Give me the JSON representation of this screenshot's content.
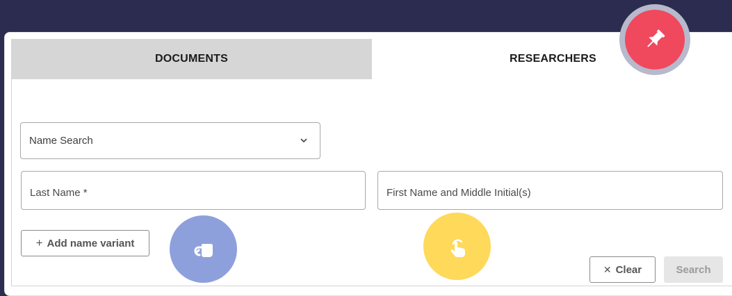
{
  "tabs": {
    "documents": "DOCUMENTS",
    "researchers": "RESEARCHERS"
  },
  "search_type": {
    "selected": "Name Search"
  },
  "fields": {
    "last_name_placeholder": "Last Name *",
    "first_name_placeholder": "First Name and Middle Initial(s)"
  },
  "buttons": {
    "add_variant_icon": "+",
    "add_variant": "Add name variant",
    "clear_icon": "✕",
    "clear": "Clear",
    "search": "Search"
  },
  "icons": {
    "pin": "pin-icon",
    "swipe": "swipe-hand-icon",
    "tap": "tap-hand-icon",
    "chevron": "chevron-down-icon"
  },
  "colors": {
    "background": "#2b2c4f",
    "active_tab": "#ffffff",
    "inactive_tab": "#d6d6d6",
    "pin_fab": "#f0485c",
    "swipe_fab": "#8ea0dc",
    "tap_fab": "#fed95a"
  }
}
